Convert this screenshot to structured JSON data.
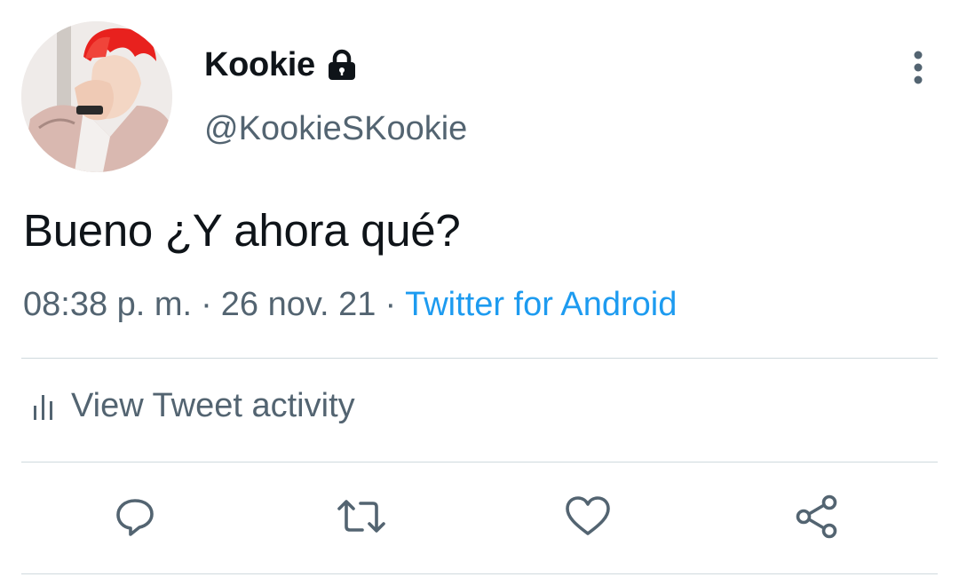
{
  "author": {
    "name": "Kookie",
    "handle": "@KookieSKookie",
    "protected_icon": "lock-icon",
    "avatar_hair_color": "#e8211e"
  },
  "tweet": {
    "text": "Bueno ¿Y ahora qué?",
    "time": "08:38 p. m.",
    "date": "26 nov. 21",
    "separator": "·",
    "source": "Twitter for Android"
  },
  "activity": {
    "label": "View Tweet activity",
    "icon": "bar-chart-icon"
  },
  "actions": [
    {
      "name": "reply-button",
      "icon": "reply-icon"
    },
    {
      "name": "retweet-button",
      "icon": "retweet-icon"
    },
    {
      "name": "like-button",
      "icon": "heart-icon"
    },
    {
      "name": "share-button",
      "icon": "share-icon"
    }
  ],
  "colors": {
    "text_primary": "#0f1419",
    "text_secondary": "#536471",
    "link": "#1d9bf0",
    "divider": "#cfd9de"
  }
}
